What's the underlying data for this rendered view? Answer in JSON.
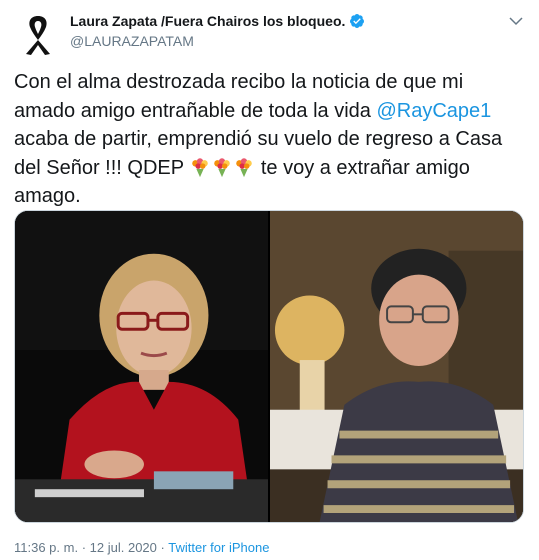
{
  "tweet": {
    "display_name": "Laura Zapata /Fuera Chairos los bloqueo.",
    "handle": "@LAURAZAPATAM",
    "text_part1": "Con el alma destrozada recibo la noticia de que mi amado amigo entrañable de toda la vida ",
    "mention": "@RayCape1",
    "text_part2": " acaba de partir, emprendió  su vuelo de regreso a Casa del Señor !!! QDEP ",
    "text_part3": " te voy a extrañar amigo amago.",
    "time": "11:36 p. m.",
    "separator": "·",
    "date": "12 jul. 2020",
    "source": "Twitter for iPhone"
  },
  "icons": {
    "avatar": "black-ribbon-icon",
    "verified": "verified-badge-icon",
    "caret": "chevron-down-icon",
    "emoji": "bouquet-emoji"
  },
  "colors": {
    "link": "#1b95e0",
    "secondary_text": "#657786",
    "primary_text": "#14171a"
  }
}
